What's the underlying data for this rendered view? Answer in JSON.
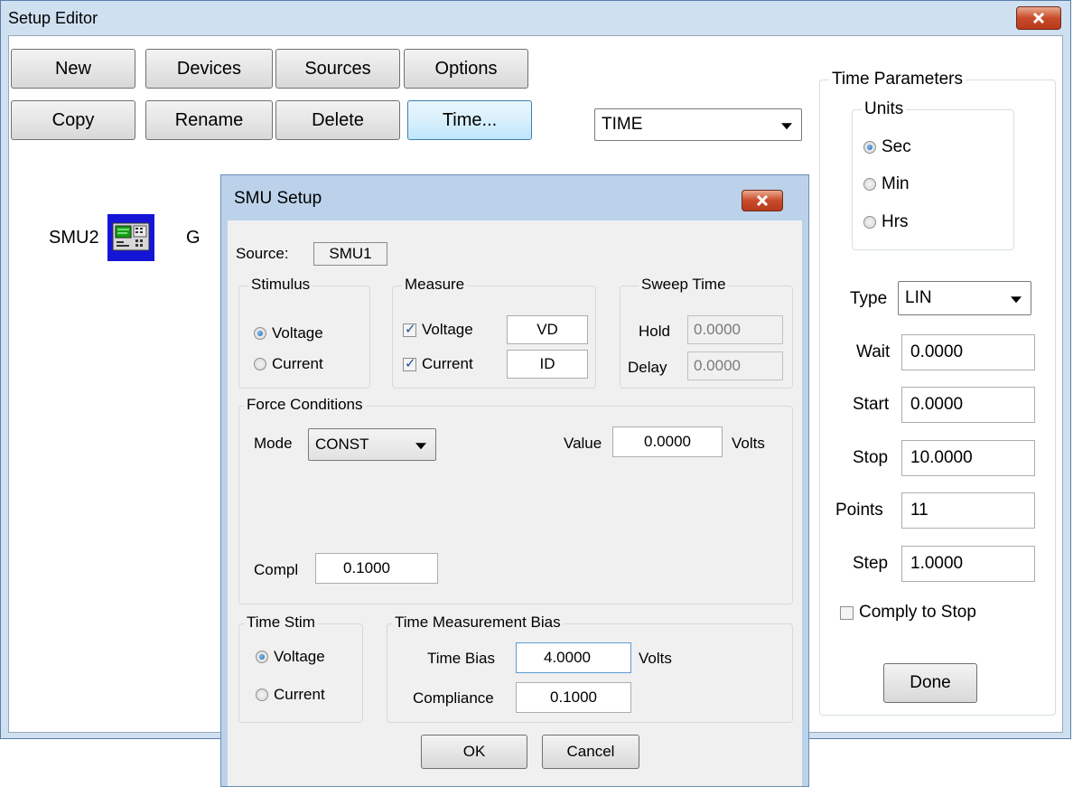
{
  "setup_editor": {
    "title": "Setup Editor",
    "toolbar": {
      "new": "New",
      "devices": "Devices",
      "sources": "Sources",
      "options": "Options",
      "copy": "Copy",
      "rename": "Rename",
      "delete": "Delete",
      "time": "Time..."
    },
    "mode_select": {
      "value": "TIME"
    },
    "canvas": {
      "smu2_label": "SMU2",
      "g_label": "G"
    },
    "time_parameters": {
      "title": "Time Parameters",
      "units": {
        "title": "Units",
        "options": [
          "Sec",
          "Min",
          "Hrs"
        ],
        "selected": "Sec"
      },
      "type_label": "Type",
      "type_value": "LIN",
      "wait_label": "Wait",
      "wait_value": "0.0000",
      "start_label": "Start",
      "start_value": "0.0000",
      "stop_label": "Stop",
      "stop_value": "10.0000",
      "points_label": "Points",
      "points_value": "11",
      "step_label": "Step",
      "step_value": "1.0000",
      "comply_label": "Comply to Stop",
      "comply_checked": false,
      "done_label": "Done"
    }
  },
  "smu_setup": {
    "title": "SMU Setup",
    "source_label": "Source:",
    "source_value": "SMU1",
    "stimulus": {
      "title": "Stimulus",
      "voltage": "Voltage",
      "current": "Current",
      "selected": "Voltage"
    },
    "measure": {
      "title": "Measure",
      "voltage_label": "Voltage",
      "voltage_name": "VD",
      "voltage_checked": true,
      "current_label": "Current",
      "current_name": "ID",
      "current_checked": true
    },
    "sweep_time": {
      "title": "Sweep Time",
      "hold_label": "Hold",
      "hold_value": "0.0000",
      "delay_label": "Delay",
      "delay_value": "0.0000"
    },
    "force_conditions": {
      "title": "Force Conditions",
      "mode_label": "Mode",
      "mode_value": "CONST",
      "value_label": "Value",
      "value_value": "0.0000",
      "value_unit": "Volts",
      "compl_label": "Compl",
      "compl_value": "0.1000"
    },
    "time_stim": {
      "title": "Time Stim",
      "voltage": "Voltage",
      "current": "Current",
      "selected": "Voltage"
    },
    "time_bias": {
      "title": "Time Measurement Bias",
      "bias_label": "Time Bias",
      "bias_value": "4.0000",
      "bias_unit": "Volts",
      "compliance_label": "Compliance",
      "compliance_value": "0.1000"
    },
    "ok_label": "OK",
    "cancel_label": "Cancel"
  },
  "colors": {
    "titlebar": "#cfe0f1",
    "close_button": "#c94b2b",
    "device_icon": "#1515d8"
  }
}
